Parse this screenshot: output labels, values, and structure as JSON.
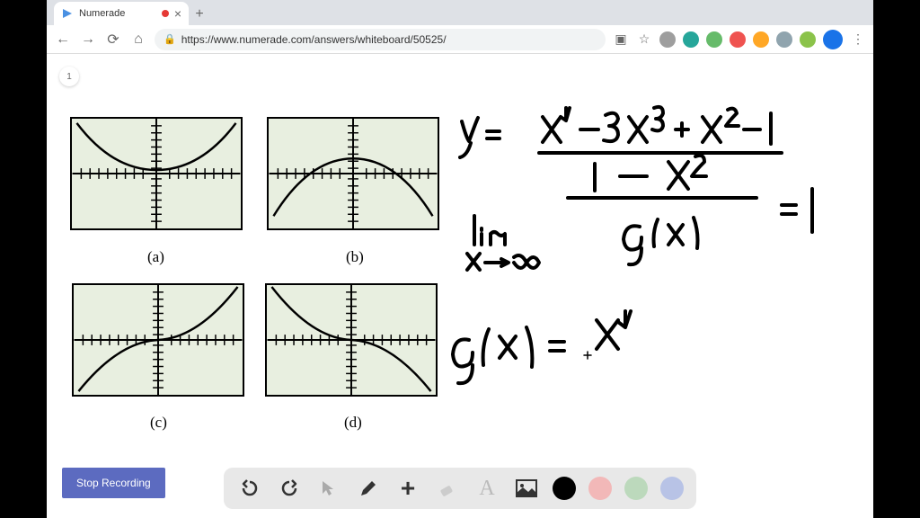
{
  "tab": {
    "title": "Numerade"
  },
  "url": "https://www.numerade.com/answers/whiteboard/50525/",
  "page_num": "1",
  "graphs": {
    "a": "(a)",
    "b": "(b)",
    "c": "(c)",
    "d": "(d)"
  },
  "handwritten": {
    "line1": "y =",
    "numerator": "x⁴ − 3x³ + x² − 1",
    "denom1": "1 − x²",
    "denom2": "g(x)",
    "equals": "= 1",
    "limit": "lim",
    "limit_sub": "x→∞",
    "gx": "g(x) =",
    "gx_val": "x⁴"
  },
  "stop_label": "Stop Recording",
  "colors": {
    "black": "#000000",
    "red": "#f2b8b8",
    "green": "#bcd9bc",
    "blue": "#b8c3e6"
  }
}
